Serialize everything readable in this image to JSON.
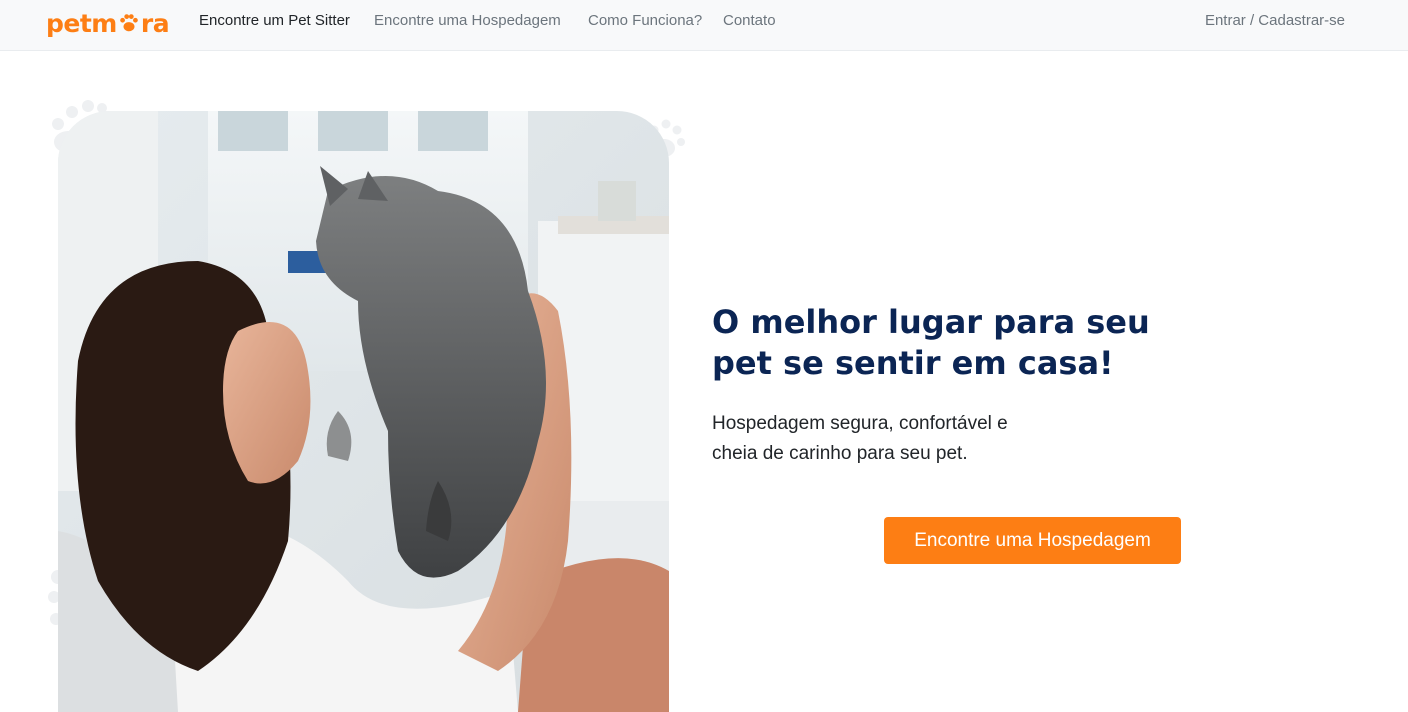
{
  "brand": {
    "logo_text_start": "petm",
    "logo_text_end": "ra",
    "color": "#fd7e14"
  },
  "nav": {
    "links": [
      {
        "label": "Encontre um Pet Sitter",
        "active": true
      },
      {
        "label": "Encontre uma Hospedagem",
        "active": false
      },
      {
        "label": "Como Funciona?",
        "active": false
      },
      {
        "label": "Contato",
        "active": false
      }
    ],
    "login_label": "Entrar / Cadastrar-se"
  },
  "hero": {
    "title": "O melhor lugar para seu pet se sentir em casa!",
    "subtitle": "Hospedagem segura, confortável e cheia de carinho para seu pet.",
    "cta_label": "Encontre uma Hospedagem",
    "image_icon": "woman-holding-cat-photo"
  },
  "colors": {
    "accent": "#fd7e14",
    "title": "#0b2554",
    "navbar_bg": "#f8f9fa"
  }
}
